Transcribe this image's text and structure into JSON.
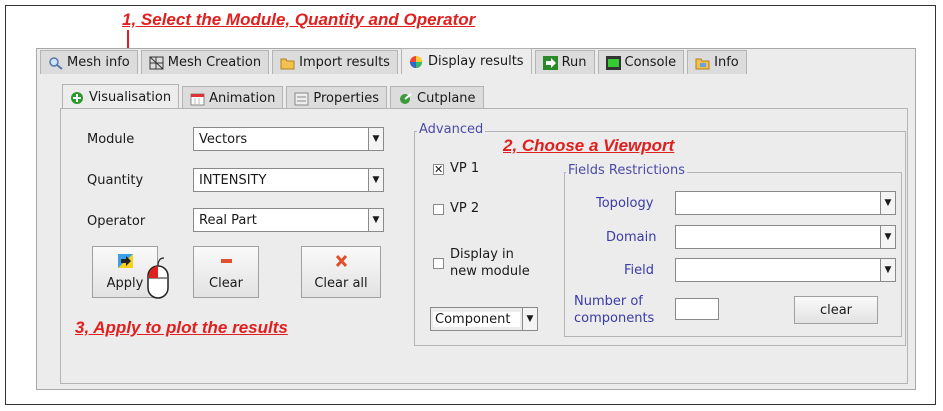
{
  "annotations": {
    "step1": "1, Select the Module, Quantity and Operator",
    "step2": "2,  Choose a Viewport",
    "step3": "3,  Apply to plot the results"
  },
  "main_tabs": [
    {
      "label": "Mesh info",
      "icon": "magnifier-icon"
    },
    {
      "label": "Mesh Creation",
      "icon": "mesh-icon"
    },
    {
      "label": "Import results",
      "icon": "folder-icon"
    },
    {
      "label": "Display results",
      "icon": "color-wheel-icon",
      "active": true
    },
    {
      "label": "Run",
      "icon": "run-arrow-icon"
    },
    {
      "label": "Console",
      "icon": "console-icon"
    },
    {
      "label": "Info",
      "icon": "info-icon"
    }
  ],
  "sub_tabs": [
    {
      "label": "Visualisation",
      "icon": "plus-circle-icon",
      "active": true
    },
    {
      "label": "Animation",
      "icon": "calendar-icon"
    },
    {
      "label": "Properties",
      "icon": "properties-icon"
    },
    {
      "label": "Cutplane",
      "icon": "cutplane-icon"
    }
  ],
  "form": {
    "module_label": "Module",
    "module_value": "Vectors",
    "quantity_label": "Quantity",
    "quantity_value": "INTENSITY",
    "operator_label": "Operator",
    "operator_value": "Real Part"
  },
  "buttons": {
    "apply": "Apply",
    "clear": "Clear",
    "clear_all": "Clear all"
  },
  "advanced": {
    "title": "Advanced",
    "vp1_label": "VP 1",
    "vp1_checked": true,
    "vp2_label": "VP 2",
    "vp2_checked": false,
    "display_new_line1": "Display in",
    "display_new_line2": "new module",
    "component_value": "Component"
  },
  "fields_restrictions": {
    "title": "Fields Restrictions",
    "topology_label": "Topology",
    "domain_label": "Domain",
    "field_label": "Field",
    "num_components_line1": "Number of",
    "num_components_line2": "components",
    "clear_button": "clear"
  },
  "colors": {
    "annotation_red": "#e0201e",
    "blue_label": "#3a3aa8"
  }
}
